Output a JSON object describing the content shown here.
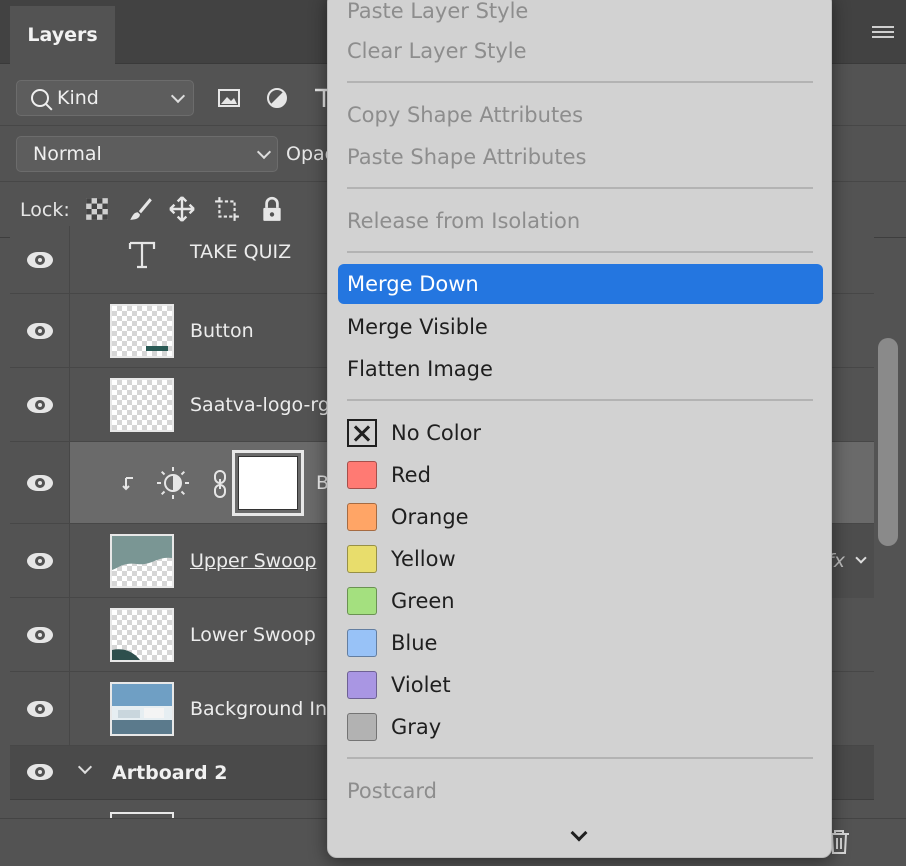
{
  "panel": {
    "tab_label": "Layers",
    "kind_filter": "Kind",
    "blend_mode": "Normal",
    "opacity_label": "Opac",
    "lock_label": "Lock:"
  },
  "layers": [
    {
      "name": "TAKE QUIZ",
      "type": "text"
    },
    {
      "name": "Button",
      "type": "shape"
    },
    {
      "name": "Saatva-logo-rg",
      "type": "image"
    },
    {
      "name": "B",
      "type": "adjustment"
    },
    {
      "name": "Upper Swoop",
      "type": "shape"
    },
    {
      "name": "Lower Swoop",
      "type": "shape"
    },
    {
      "name": "Background In",
      "type": "image"
    }
  ],
  "artboard": {
    "name": "Artboard 2"
  },
  "fx_label": "fx",
  "menu": {
    "items": [
      {
        "label": "Paste Layer Style",
        "disabled": true
      },
      {
        "label": "Clear Layer Style",
        "disabled": true
      },
      {
        "label": "Copy Shape Attributes",
        "disabled": true
      },
      {
        "label": "Paste Shape Attributes",
        "disabled": true
      },
      {
        "label": "Release from Isolation",
        "disabled": true
      },
      {
        "label": "Merge Down",
        "active": true
      },
      {
        "label": "Merge Visible"
      },
      {
        "label": "Flatten Image"
      },
      {
        "label": "No Color"
      },
      {
        "label": "Red",
        "color": "#ff7a73"
      },
      {
        "label": "Orange",
        "color": "#ffa566"
      },
      {
        "label": "Yellow",
        "color": "#e8dd6c"
      },
      {
        "label": "Green",
        "color": "#a4e07f"
      },
      {
        "label": "Blue",
        "color": "#98c2f7"
      },
      {
        "label": "Violet",
        "color": "#a996e3"
      },
      {
        "label": "Gray",
        "color": "#b2b2b2"
      },
      {
        "label": "Postcard",
        "disabled": true
      }
    ]
  }
}
